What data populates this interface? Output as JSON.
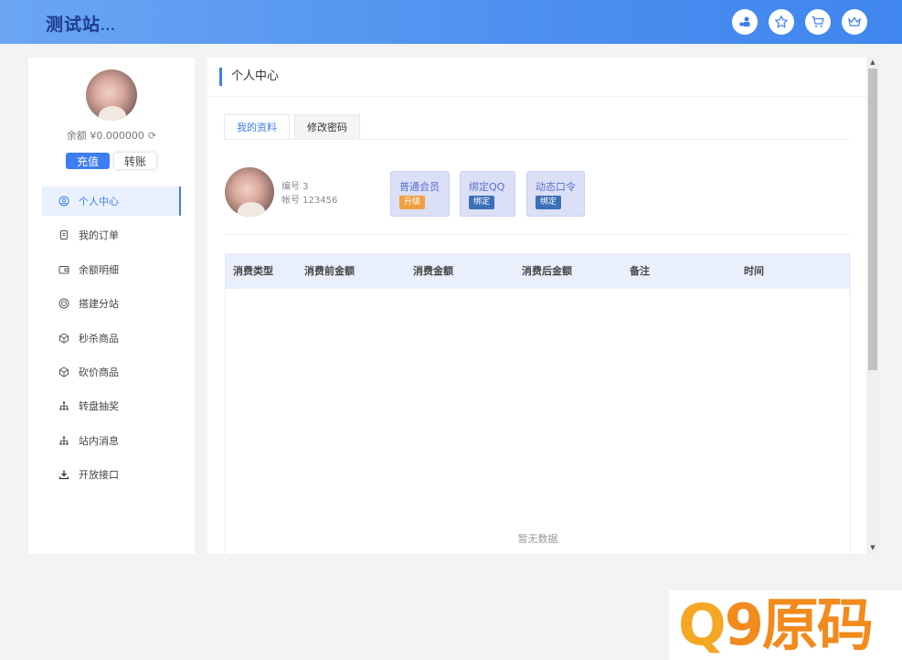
{
  "header": {
    "logo": "测试站",
    "logo_suffix": "...",
    "icons": [
      "users-icon",
      "star-icon",
      "cart-icon",
      "crown-icon"
    ]
  },
  "sidebar": {
    "balance": "余额 ¥0.000000",
    "recharge_label": "充值",
    "transfer_label": "转账",
    "items": [
      {
        "label": "个人中心",
        "icon": "user-icon",
        "active": true
      },
      {
        "label": "我的订单",
        "icon": "order-icon",
        "active": false
      },
      {
        "label": "余额明细",
        "icon": "wallet-icon",
        "active": false
      },
      {
        "label": "搭建分站",
        "icon": "site-icon",
        "active": false
      },
      {
        "label": "秒杀商品",
        "icon": "box-icon",
        "active": false
      },
      {
        "label": "砍价商品",
        "icon": "box-icon",
        "active": false
      },
      {
        "label": "转盘抽奖",
        "icon": "tree-icon",
        "active": false
      },
      {
        "label": "站内消息",
        "icon": "tree-icon",
        "active": false
      },
      {
        "label": "开放接口",
        "icon": "download-icon",
        "active": false
      }
    ]
  },
  "main": {
    "title": "个人中心",
    "tabs": [
      {
        "label": "我的资料",
        "active": true
      },
      {
        "label": "修改密码",
        "active": false
      }
    ],
    "profile": {
      "id_line": "编号 3",
      "account_line": "帐号 123456"
    },
    "badges": [
      {
        "label": "普通会员",
        "tag": "升级",
        "tag_color": "#f0a040"
      },
      {
        "label": "绑定QQ",
        "tag": "绑定",
        "tag_color": "#3c6fb8"
      },
      {
        "label": "动态口令",
        "tag": "绑定",
        "tag_color": "#3c6fb8"
      }
    ],
    "table": {
      "columns": [
        "消费类型",
        "消费前金额",
        "消费金额",
        "消费后金额",
        "备注",
        "时间"
      ],
      "rows": [],
      "empty_text": "暂无数据"
    }
  },
  "watermark": {
    "text_q": "Q",
    "text_rest": "9原码"
  },
  "colors": {
    "accent": "#3d7ef0",
    "header_gradient_start": "#6aa6f2",
    "header_gradient_end": "#3f86ee"
  }
}
